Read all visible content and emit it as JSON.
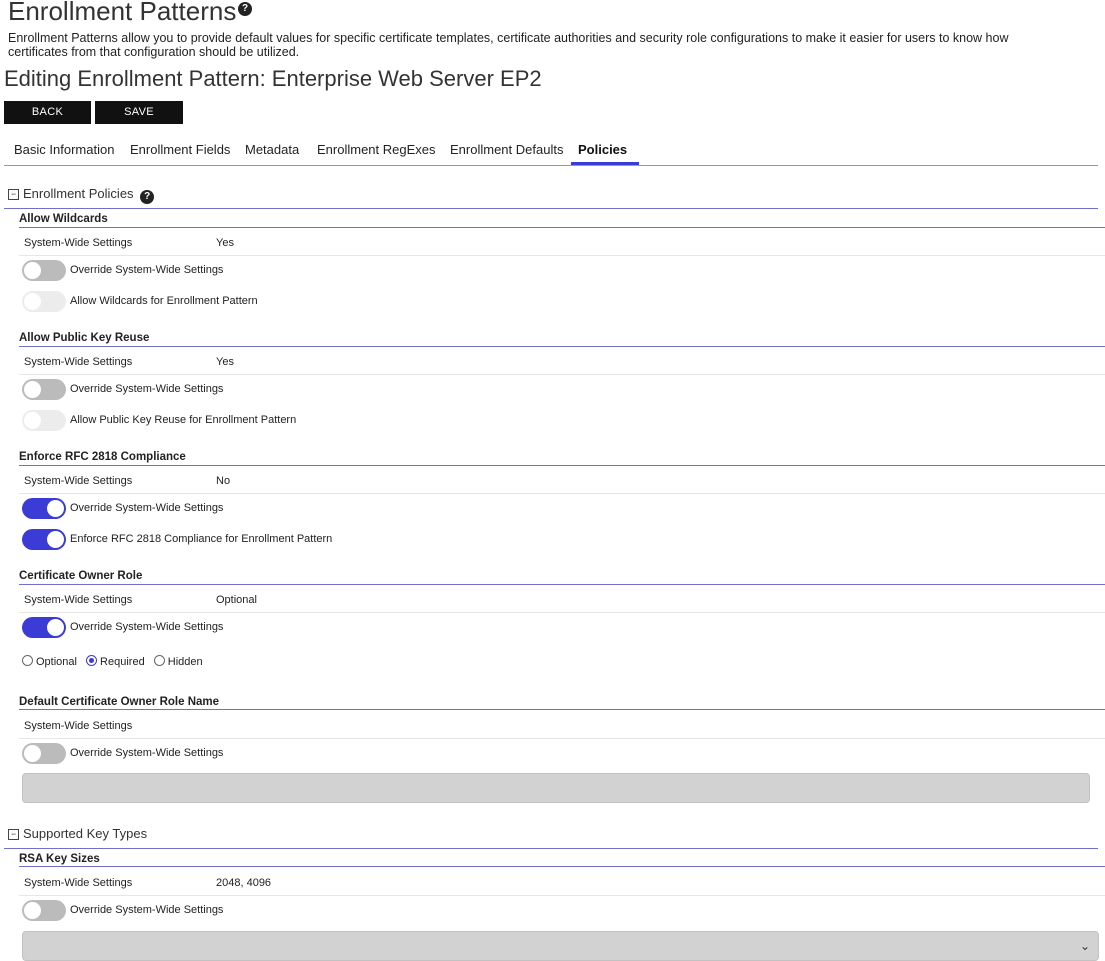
{
  "page": {
    "title": "Enrollment Patterns",
    "description": "Enrollment Patterns allow you to provide default values for specific certificate templates, certificate authorities and security role configurations to make it easier for users to know how certificates from that configuration should be utilized.",
    "subtitle": "Editing Enrollment Pattern: Enterprise Web Server EP2"
  },
  "toolbar": {
    "back_label": "BACK",
    "save_label": "SAVE"
  },
  "tabs": [
    {
      "label": "Basic Information"
    },
    {
      "label": "Enrollment Fields"
    },
    {
      "label": "Metadata"
    },
    {
      "label": "Enrollment RegExes"
    },
    {
      "label": "Enrollment Defaults"
    },
    {
      "label": "Policies",
      "active": true
    }
  ],
  "enrollment_policies": {
    "heading": "Enrollment Policies",
    "allow_wildcards": {
      "title": "Allow Wildcards",
      "system_label": "System-Wide Settings",
      "system_value": "Yes",
      "override_label": "Override System-Wide Settings",
      "override_on": false,
      "policy_label": "Allow Wildcards for Enrollment Pattern",
      "policy_on": false
    },
    "allow_key_reuse": {
      "title": "Allow Public Key Reuse",
      "system_label": "System-Wide Settings",
      "system_value": "Yes",
      "override_label": "Override System-Wide Settings",
      "override_on": false,
      "policy_label": "Allow Public Key Reuse for Enrollment Pattern",
      "policy_on": false
    },
    "rfc2818": {
      "title": "Enforce RFC 2818 Compliance",
      "system_label": "System-Wide Settings",
      "system_value": "No",
      "override_label": "Override System-Wide Settings",
      "override_on": true,
      "policy_label": "Enforce RFC 2818 Compliance for Enrollment Pattern",
      "policy_on": true
    },
    "owner_role": {
      "title": "Certificate Owner Role",
      "system_label": "System-Wide Settings",
      "system_value": "Optional",
      "override_label": "Override System-Wide Settings",
      "override_on": true,
      "options": [
        "Optional",
        "Required",
        "Hidden"
      ],
      "selected": "Required"
    },
    "default_owner_role_name": {
      "title": "Default Certificate Owner Role Name",
      "system_label": "System-Wide Settings",
      "system_value": "",
      "override_label": "Override System-Wide Settings",
      "override_on": false,
      "field_value": ""
    }
  },
  "supported_key_types": {
    "heading": "Supported Key Types",
    "rsa": {
      "title": "RSA Key Sizes",
      "system_label": "System-Wide Settings",
      "system_value": "2048, 4096",
      "override_label": "Override System-Wide Settings",
      "override_on": false,
      "select_value": ""
    }
  },
  "colors": {
    "accent": "#3b3bd6",
    "button_bg": "#111111",
    "section_line": "#7070cc"
  }
}
